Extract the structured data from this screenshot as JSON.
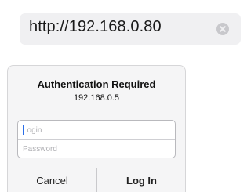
{
  "address_bar": {
    "url": "http://192.168.0.80",
    "clear_icon": "clear-circle-x"
  },
  "auth_dialog": {
    "title": "Authentication Required",
    "host": "192.168.0.5",
    "login_placeholder": "Login",
    "password_placeholder": "Password",
    "cancel_label": "Cancel",
    "login_label": "Log In"
  }
}
